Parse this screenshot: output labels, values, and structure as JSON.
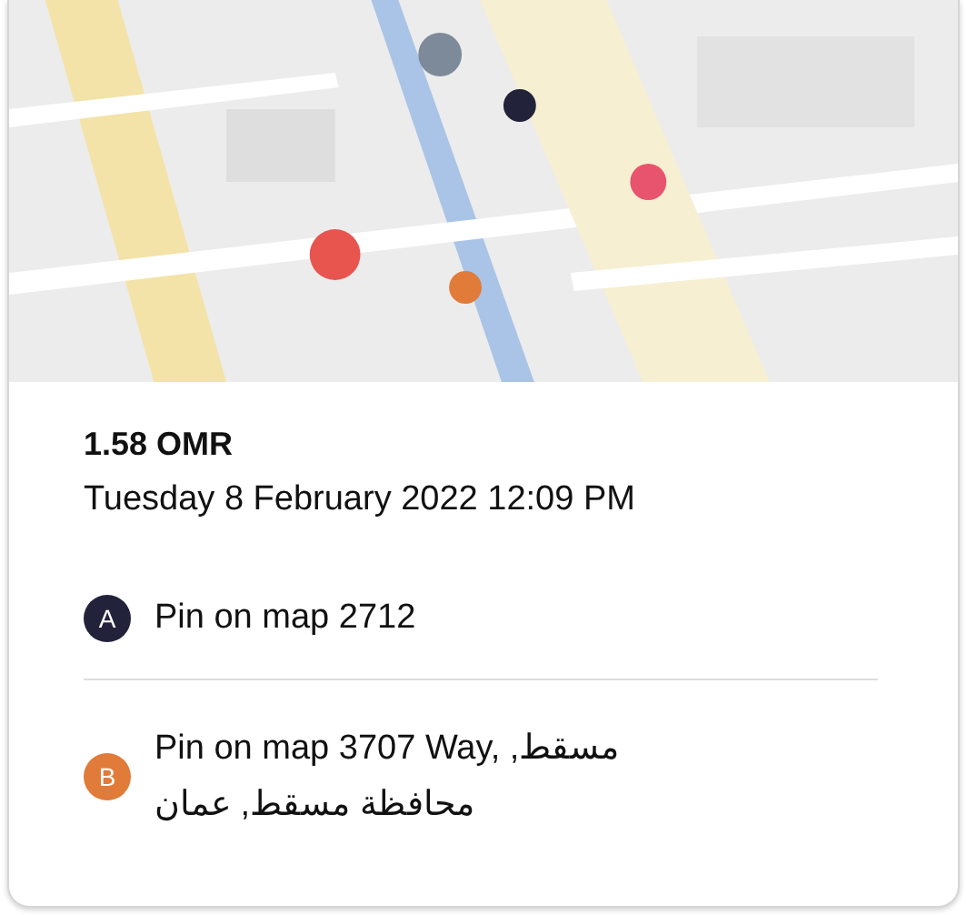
{
  "trip": {
    "price": "1.58 OMR",
    "date": "Tuesday 8 February 2022 12:09 PM"
  },
  "stops": [
    {
      "marker": "A",
      "color": "#22223a",
      "address": "Pin on map 2712"
    },
    {
      "marker": "B",
      "color": "#e07b39",
      "address": "Pin on map 3707 Way, مسقط, محافظة مسقط, عمان"
    }
  ]
}
